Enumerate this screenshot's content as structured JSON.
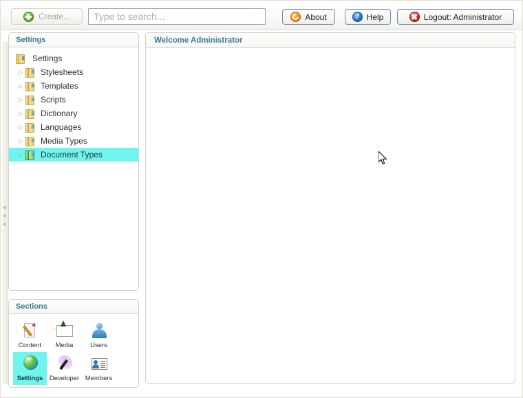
{
  "toolbar": {
    "create_label": "Create...",
    "create_icon": "plus-circle-green-icon",
    "search_placeholder": "Type to search...",
    "search_value": "",
    "about_label": "About",
    "about_icon": "refresh-circle-orange-icon",
    "help_label": "Help",
    "help_icon": "question-circle-blue-icon",
    "help_glyph": "?",
    "logout_label": "Logout: Administrator",
    "logout_icon": "close-circle-red-icon"
  },
  "settings_panel": {
    "header": "Settings",
    "tree": [
      {
        "label": "Settings",
        "level": 0,
        "expandable": false,
        "selected": false,
        "icon": "folder-yellow-icon"
      },
      {
        "label": "Stylesheets",
        "level": 1,
        "expandable": true,
        "selected": false,
        "icon": "folder-yellow-icon"
      },
      {
        "label": "Templates",
        "level": 1,
        "expandable": true,
        "selected": false,
        "icon": "folder-yellow-icon"
      },
      {
        "label": "Scripts",
        "level": 1,
        "expandable": true,
        "selected": false,
        "icon": "folder-yellow-icon"
      },
      {
        "label": "Dictionary",
        "level": 1,
        "expandable": true,
        "selected": false,
        "icon": "folder-yellow-icon"
      },
      {
        "label": "Languages",
        "level": 1,
        "expandable": true,
        "selected": false,
        "icon": "folder-yellow-icon"
      },
      {
        "label": "Media Types",
        "level": 1,
        "expandable": true,
        "selected": false,
        "icon": "folder-yellow-icon"
      },
      {
        "label": "Document Types",
        "level": 1,
        "expandable": true,
        "selected": true,
        "icon": "folder-green-icon"
      }
    ],
    "expand_arrow": "▷"
  },
  "sections_panel": {
    "header": "Sections",
    "items": [
      {
        "label": "Content",
        "icon": "page-pencil-icon",
        "selected": false
      },
      {
        "label": "Media",
        "icon": "picture-frame-icon",
        "selected": false
      },
      {
        "label": "Users",
        "icon": "person-bust-icon",
        "selected": false
      },
      {
        "label": "Settings",
        "icon": "globe-sphere-icon",
        "selected": true
      },
      {
        "label": "Developer",
        "icon": "magic-wand-icon",
        "selected": false
      },
      {
        "label": "Members",
        "icon": "member-card-icon",
        "selected": false
      }
    ]
  },
  "main_panel": {
    "header": "Welcome Administrator",
    "body_text": ""
  },
  "collapse_handle": {
    "icon": "triangle-left-icon",
    "count": 3
  },
  "colors": {
    "selection": "#6ff5ef",
    "panel_header_text": "#3a7d8c",
    "page_background": "#f3f2e8",
    "panel_border": "#cfcfc9"
  }
}
